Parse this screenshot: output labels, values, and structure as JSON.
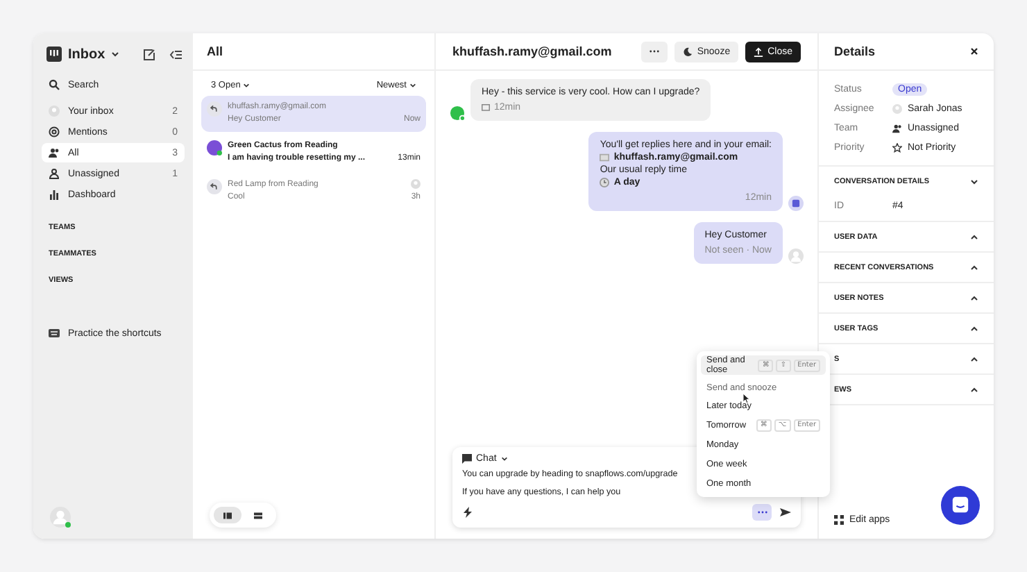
{
  "sidebar": {
    "title": "Inbox",
    "search": "Search",
    "items": [
      {
        "kind": "avatar",
        "label": "Your inbox",
        "count": "2",
        "selected": false
      },
      {
        "kind": "mention",
        "label": "Mentions",
        "count": "0",
        "selected": false
      },
      {
        "kind": "people",
        "label": "All",
        "count": "3",
        "selected": true
      },
      {
        "kind": "unassigned",
        "label": "Unassigned",
        "count": "1",
        "selected": false
      },
      {
        "kind": "chart",
        "label": "Dashboard",
        "selected": false
      }
    ],
    "sections": [
      "TEAMS",
      "TEAMMATES",
      "VIEWS"
    ],
    "shortcuts": "Practice the shortcuts"
  },
  "list": {
    "title": "All",
    "filter": "3 Open",
    "sort": "Newest",
    "conversations": [
      {
        "kind": "reply",
        "name": "khuffash.ramy@gmail.com",
        "preview": "Hey Customer",
        "time": "Now",
        "selected": true,
        "unread": false
      },
      {
        "kind": "avatar",
        "name": "Green Cactus from Reading",
        "preview": "I am having trouble resetting my ...",
        "time": "13min",
        "selected": false,
        "unread": true
      },
      {
        "kind": "reply",
        "name": "Red Lamp from Reading",
        "preview": "Cool",
        "time": "3h",
        "selected": false,
        "unread": false
      }
    ],
    "view_toggle": [
      {
        "selected": true
      },
      {
        "selected": false
      }
    ]
  },
  "conversation": {
    "title": "khuffash.ramy@gmail.com",
    "snooze": "Snooze",
    "close": "Close",
    "messages": [
      {
        "kind": "customer",
        "lines": [
          {
            "kind": "text",
            "text": "Hey - this service is very cool. How can I upgrade?"
          }
        ],
        "meta": "12min"
      },
      {
        "kind": "bot",
        "lines": [
          {
            "kind": "text",
            "text": "You'll get replies here and in your email:"
          },
          {
            "kind": "email",
            "text": "khuffash.ramy@gmail.com"
          },
          {
            "kind": "text",
            "text": "Our usual reply time"
          },
          {
            "kind": "clock",
            "text": "A day"
          }
        ],
        "meta": "12min"
      },
      {
        "kind": "agent",
        "lines": [
          {
            "kind": "text",
            "text": "Hey Customer"
          }
        ],
        "meta": "Not seen · Now"
      }
    ],
    "composer": {
      "channel": "Chat",
      "lines": [
        "You can upgrade by heading to snapflows.com/upgrade",
        "If you have any questions, I can help you"
      ]
    },
    "menu": [
      {
        "kind": "option",
        "label": "Send and close",
        "selected": true,
        "keys": [
          "⌘",
          "⇧",
          "Enter"
        ]
      },
      {
        "kind": "header",
        "label": "Send and snooze"
      },
      {
        "kind": "option",
        "label": "Later today",
        "selected": false
      },
      {
        "kind": "option",
        "label": "Tomorrow",
        "selected": false,
        "keys": [
          "⌘",
          "⌥",
          "Enter"
        ]
      },
      {
        "kind": "option",
        "label": "Monday",
        "selected": false
      },
      {
        "kind": "option",
        "label": "One week",
        "selected": false
      },
      {
        "kind": "option",
        "label": "One month",
        "selected": false
      }
    ]
  },
  "details": {
    "title": "Details",
    "fields": [
      {
        "kind": "badge",
        "label": "Status",
        "value": "Open"
      },
      {
        "kind": "person",
        "label": "Assignee",
        "value": "Sarah Jonas"
      },
      {
        "kind": "team",
        "label": "Team",
        "value": "Unassigned"
      },
      {
        "kind": "star",
        "label": "Priority",
        "value": "Not Priority"
      }
    ],
    "sections": [
      {
        "title": "CONVERSATION DETAILS",
        "expanded": true,
        "rows": [
          {
            "label": "ID",
            "value": "#4"
          }
        ]
      },
      {
        "title": "USER DATA",
        "expanded": false
      },
      {
        "title": "RECENT CONVERSATIONS",
        "expanded": false
      },
      {
        "title": "USER NOTES",
        "expanded": false
      },
      {
        "title": "USER TAGS",
        "expanded": false
      },
      {
        "title": "S",
        "expanded": false
      },
      {
        "title": "EWS",
        "expanded": false
      }
    ],
    "edit_apps": "Edit apps"
  }
}
